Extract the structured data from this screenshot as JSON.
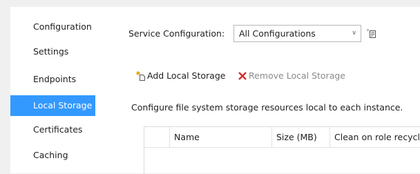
{
  "sidebar": {
    "items": [
      {
        "label": "Configuration",
        "selected": false
      },
      {
        "label": "Settings",
        "selected": false
      },
      {
        "label": "Endpoints",
        "selected": false
      },
      {
        "label": "Local Storage",
        "selected": true
      },
      {
        "label": "Certificates",
        "selected": false
      },
      {
        "label": "Caching",
        "selected": false
      }
    ]
  },
  "service_configuration": {
    "label": "Service Configuration:",
    "selected": "All Configurations",
    "properties_icon": "properties-icon"
  },
  "toolbar": {
    "add_label": "Add Local Storage",
    "add_icon": "add-item-icon",
    "remove_label": "Remove Local Storage",
    "remove_icon": "red-x-icon"
  },
  "description": "Configure file system storage resources local to each instance.",
  "table": {
    "columns": [
      "Name",
      "Size (MB)",
      "Clean on role recycle"
    ],
    "rows": []
  },
  "colors": {
    "selection": "#3399ff",
    "remove_icon": "#d32f2f",
    "disabled_text": "#8a8a8a"
  }
}
